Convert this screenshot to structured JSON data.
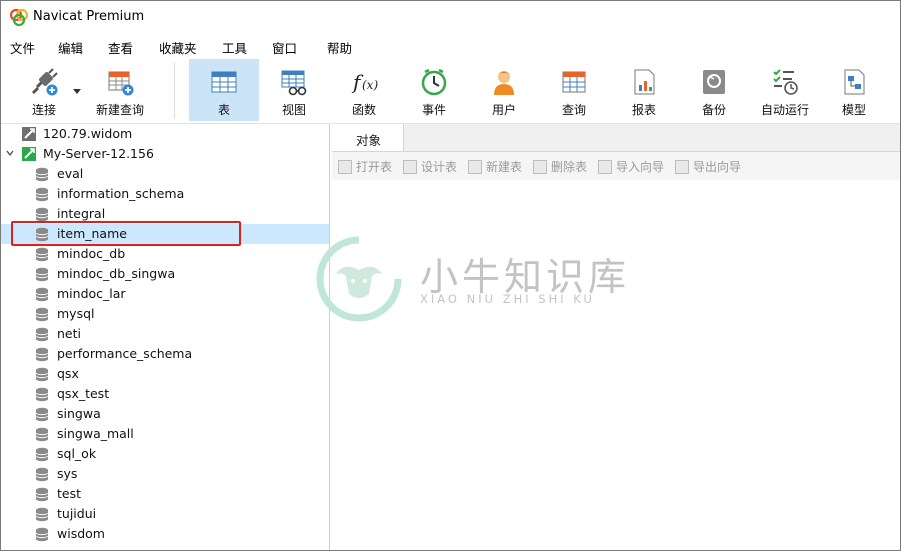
{
  "window": {
    "title": "Navicat Premium"
  },
  "menu": [
    "文件",
    "编辑",
    "查看",
    "收藏夹",
    "工具",
    "窗口",
    "帮助"
  ],
  "toolbar": {
    "buttons": [
      {
        "label": "连接",
        "icon": "connect-icon"
      },
      {
        "label": "新建查询",
        "icon": "new-query-icon"
      },
      {
        "label": "表",
        "icon": "table-icon"
      },
      {
        "label": "视图",
        "icon": "view-icon"
      },
      {
        "label": "函数",
        "icon": "function-icon"
      },
      {
        "label": "事件",
        "icon": "event-clock-icon"
      },
      {
        "label": "用户",
        "icon": "user-icon"
      },
      {
        "label": "查询",
        "icon": "query-icon"
      },
      {
        "label": "报表",
        "icon": "report-icon"
      },
      {
        "label": "备份",
        "icon": "backup-icon"
      },
      {
        "label": "自动运行",
        "icon": "automation-icon"
      },
      {
        "label": "模型",
        "icon": "model-icon"
      }
    ],
    "active": "表"
  },
  "tree": {
    "connections": [
      {
        "label": "120.79.widom",
        "state": "disconnected"
      },
      {
        "label": "My-Server-12.156",
        "state": "connected",
        "expanded": true
      }
    ],
    "databases": [
      "eval",
      "information_schema",
      "integral",
      "item_name",
      "mindoc_db",
      "mindoc_db_singwa",
      "mindoc_lar",
      "mysql",
      "neti",
      "performance_schema",
      "qsx",
      "qsx_test",
      "singwa",
      "singwa_mall",
      "sql_ok",
      "sys",
      "test",
      "tujidui",
      "wisdom"
    ],
    "selected": "item_name"
  },
  "main": {
    "tab_label": "对象",
    "object_toolbar": [
      "打开表",
      "设计表",
      "新建表",
      "删除表",
      "导入向导",
      "导出向导"
    ]
  },
  "watermark": {
    "title": "小牛知识库",
    "subtitle": "XIAO NIU ZHI SHI KU"
  },
  "colors": {
    "selection": "#cce8ff",
    "active_toolbar": "#cce4f7",
    "highlight_box": "#e0211b",
    "connected": "#2aa84a"
  }
}
